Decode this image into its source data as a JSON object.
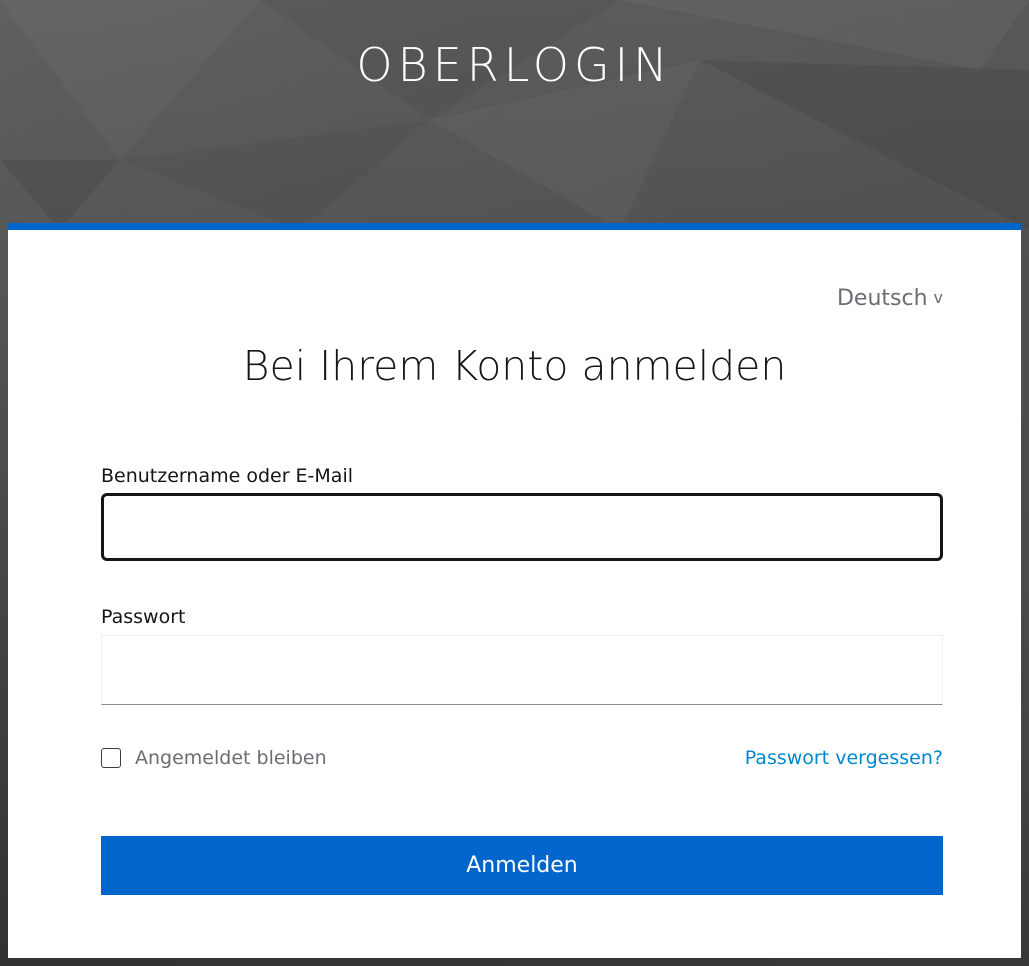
{
  "brand": {
    "title": "OBERLOGIN"
  },
  "language": {
    "current": "Deutsch",
    "chevron": "v"
  },
  "form": {
    "title": "Bei Ihrem Konto anmelden",
    "username": {
      "label": "Benutzername oder E-Mail",
      "value": "",
      "placeholder": ""
    },
    "password": {
      "label": "Passwort",
      "value": "",
      "placeholder": ""
    },
    "remember_me": {
      "label": "Angemeldet bleiben",
      "checked": false
    },
    "forgot_password": "Passwort vergessen?",
    "submit": "Anmelden"
  },
  "colors": {
    "accent": "#0066cc",
    "link": "#0088ce",
    "background": "#4a4a4a"
  }
}
